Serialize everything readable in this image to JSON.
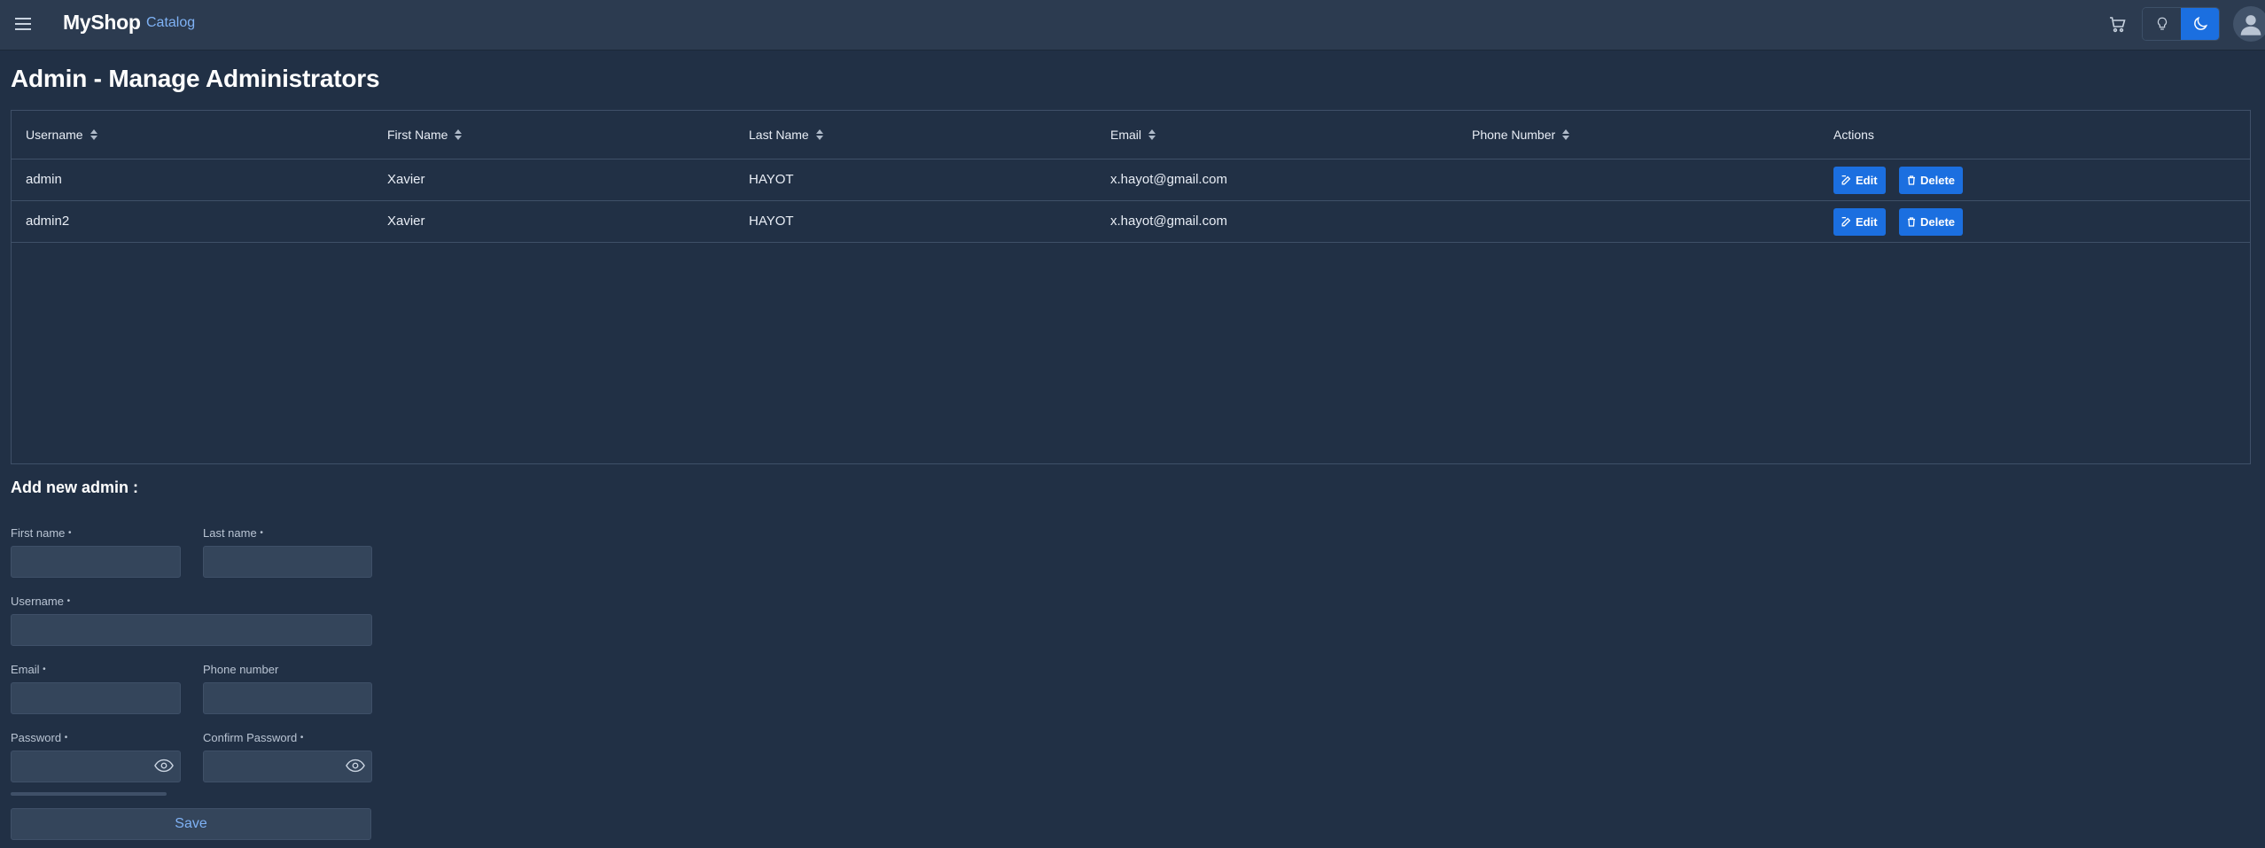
{
  "header": {
    "brand": "MyShop",
    "nav_catalog": "Catalog",
    "icons": [
      "menu-icon",
      "cart-icon",
      "lightbulb-icon",
      "moon-icon",
      "user-icon"
    ],
    "active_theme": "dark",
    "accent_color": "#1b6fe0"
  },
  "page": {
    "title": "Admin - Manage Administrators"
  },
  "table": {
    "columns": [
      "Username",
      "First Name",
      "Last Name",
      "Email",
      "Phone Number",
      "Actions"
    ],
    "rows": [
      {
        "username": "admin",
        "first_name": "Xavier",
        "last_name": "HAYOT",
        "email": "x.hayot@gmail.com",
        "phone": "",
        "edit": "Edit",
        "delete": "Delete"
      },
      {
        "username": "admin2",
        "first_name": "Xavier",
        "last_name": "HAYOT",
        "email": "x.hayot@gmail.com",
        "phone": "",
        "edit": "Edit",
        "delete": "Delete"
      }
    ]
  },
  "form": {
    "title": "Add new admin :",
    "required_mark": "•",
    "first_name": {
      "label": "First name",
      "value": ""
    },
    "last_name": {
      "label": "Last name",
      "value": ""
    },
    "username": {
      "label": "Username",
      "value": ""
    },
    "email": {
      "label": "Email",
      "value": ""
    },
    "phone": {
      "label": "Phone number",
      "value": ""
    },
    "password": {
      "label": "Password",
      "value": ""
    },
    "confirm_password": {
      "label": "Confirm Password",
      "value": ""
    },
    "save_label": "Save"
  }
}
